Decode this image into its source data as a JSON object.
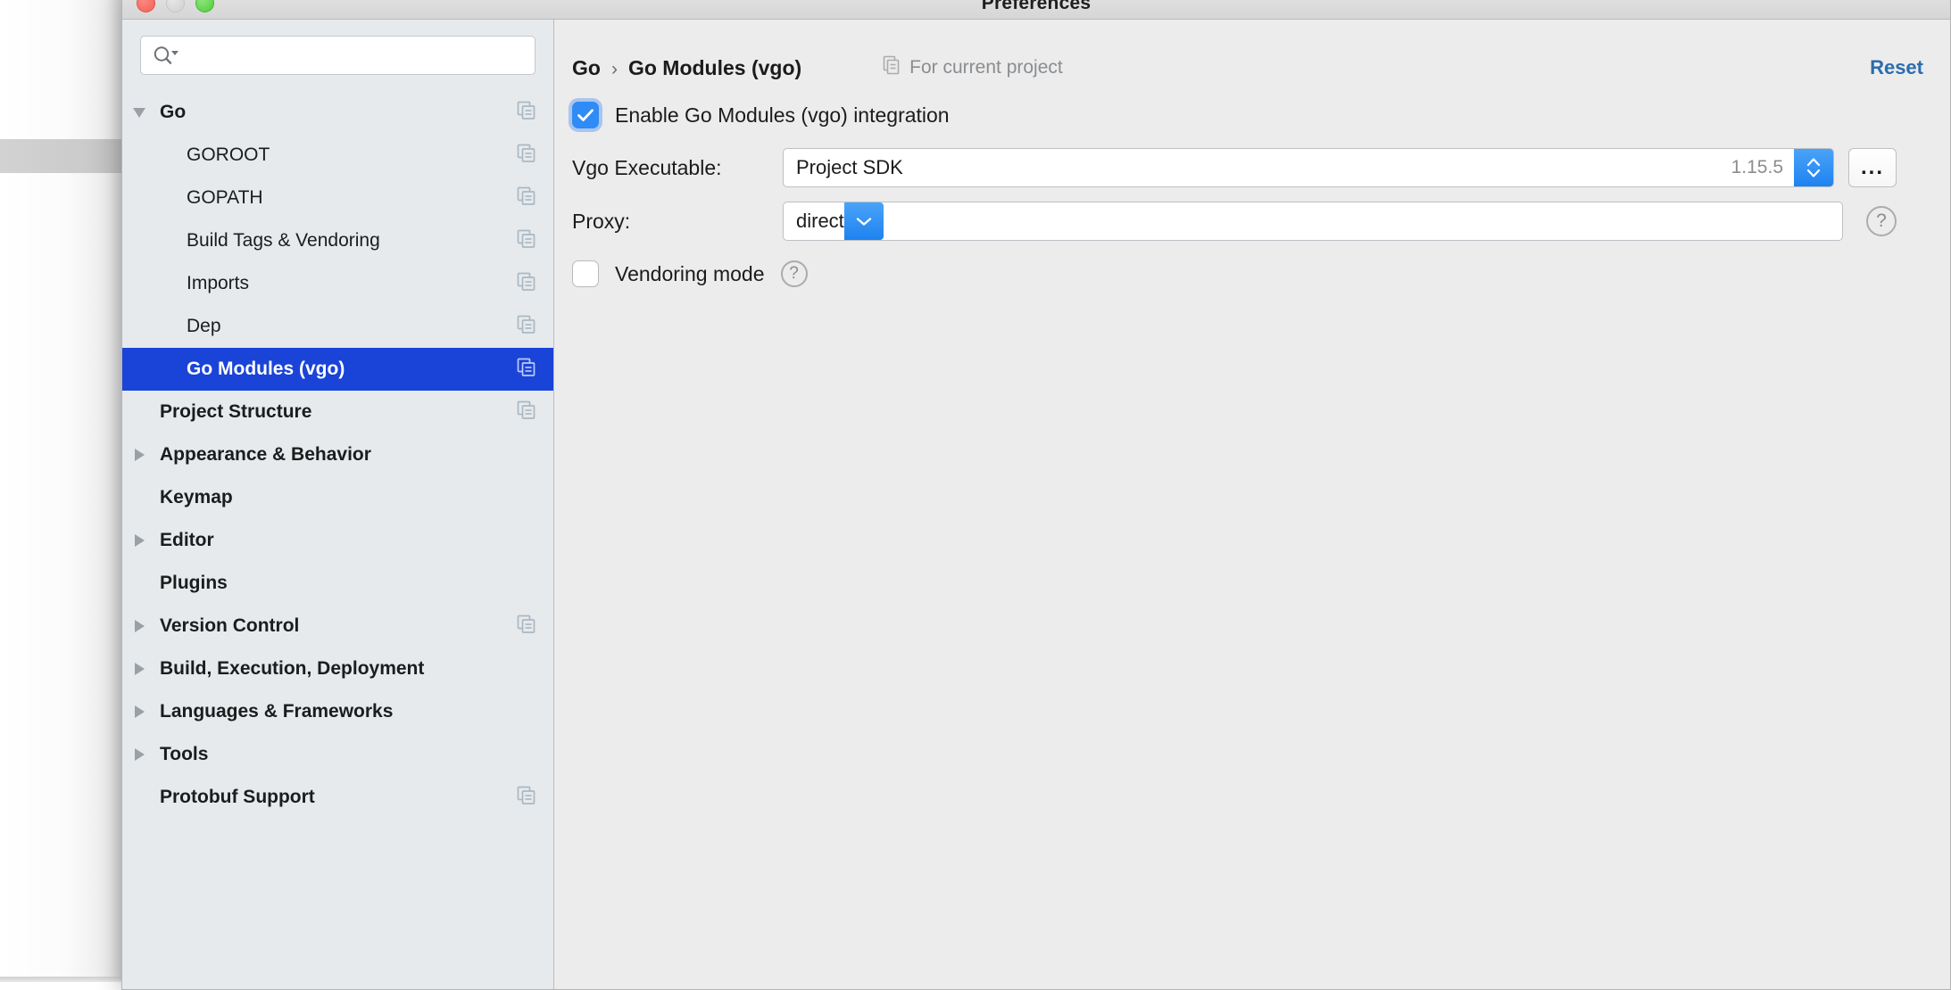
{
  "window": {
    "title": "Preferences",
    "traffic_lights": [
      "close",
      "minimize",
      "zoom"
    ]
  },
  "sidebar": {
    "search": {
      "value": "",
      "placeholder": ""
    },
    "items": [
      {
        "label": "Go",
        "depth": 0,
        "twisty": "down",
        "copy": true,
        "selected": false
      },
      {
        "label": "GOROOT",
        "depth": 1,
        "twisty": "none",
        "copy": true,
        "selected": false
      },
      {
        "label": "GOPATH",
        "depth": 1,
        "twisty": "none",
        "copy": true,
        "selected": false
      },
      {
        "label": "Build Tags & Vendoring",
        "depth": 1,
        "twisty": "none",
        "copy": true,
        "selected": false
      },
      {
        "label": "Imports",
        "depth": 1,
        "twisty": "none",
        "copy": true,
        "selected": false
      },
      {
        "label": "Dep",
        "depth": 1,
        "twisty": "none",
        "copy": true,
        "selected": false
      },
      {
        "label": "Go Modules (vgo)",
        "depth": 1,
        "twisty": "none",
        "copy": true,
        "selected": true
      },
      {
        "label": "Project Structure",
        "depth": 0,
        "twisty": "none",
        "copy": true,
        "selected": false
      },
      {
        "label": "Appearance & Behavior",
        "depth": 0,
        "twisty": "right",
        "copy": false,
        "selected": false
      },
      {
        "label": "Keymap",
        "depth": 0,
        "twisty": "none",
        "copy": false,
        "selected": false
      },
      {
        "label": "Editor",
        "depth": 0,
        "twisty": "right",
        "copy": false,
        "selected": false
      },
      {
        "label": "Plugins",
        "depth": 0,
        "twisty": "none",
        "copy": false,
        "selected": false
      },
      {
        "label": "Version Control",
        "depth": 0,
        "twisty": "right",
        "copy": true,
        "selected": false
      },
      {
        "label": "Build, Execution, Deployment",
        "depth": 0,
        "twisty": "right",
        "copy": false,
        "selected": false
      },
      {
        "label": "Languages & Frameworks",
        "depth": 0,
        "twisty": "right",
        "copy": false,
        "selected": false
      },
      {
        "label": "Tools",
        "depth": 0,
        "twisty": "right",
        "copy": false,
        "selected": false
      },
      {
        "label": "Protobuf Support",
        "depth": 0,
        "twisty": "none",
        "copy": true,
        "selected": false
      }
    ]
  },
  "content": {
    "breadcrumb_root": "Go",
    "breadcrumb_sep": "›",
    "breadcrumb_current": "Go Modules (vgo)",
    "scope_note": "For current project",
    "reset_label": "Reset",
    "enable_checkbox": {
      "label": "Enable Go Modules (vgo) integration",
      "checked": true
    },
    "vgo_executable": {
      "label": "Vgo Executable:",
      "value": "Project SDK",
      "version": "1.15.5",
      "browse_label": "..."
    },
    "proxy": {
      "label": "Proxy:",
      "value": "direct"
    },
    "vendoring": {
      "label": "Vendoring mode",
      "checked": false,
      "help_glyph": "?"
    },
    "help_glyph": "?"
  },
  "colors": {
    "selection_blue": "#1a43d8",
    "accent_blue": "#2f8bf5",
    "link_blue": "#2b6cb0",
    "sidebar_bg": "#e6eaed",
    "content_bg": "#ececec"
  }
}
